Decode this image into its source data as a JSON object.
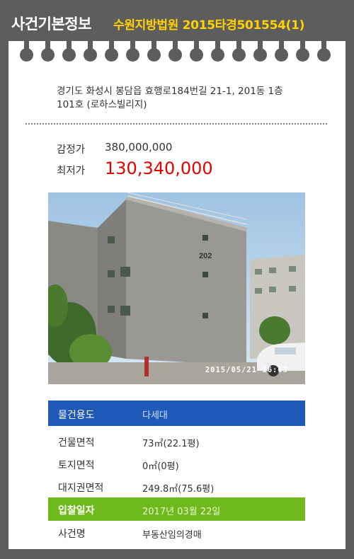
{
  "header": {
    "title": "사건기본정보",
    "case": "수원지방법원 2015타경501554(1)"
  },
  "address": "경기도 화성시 봉담읍 효행로184번길 21-1, 201동 1층101호 (로하스빌리지)",
  "price": {
    "appraisal_label": "감정가",
    "appraisal_value": "380,000,000",
    "lowest_label": "최저가",
    "lowest_value": "130,340,000"
  },
  "photo": {
    "timestamp": "2015/05/21  16:03",
    "building_number": "202"
  },
  "info_rows": [
    {
      "key": "물건용도",
      "value": "다세대"
    },
    {
      "key": "건물면적",
      "value": "73㎡(22.1평)"
    },
    {
      "key": "토지면적",
      "value": "0㎡(0평)"
    },
    {
      "key": "대지권면적",
      "value": "249.8㎡(75.6평)"
    },
    {
      "key": "입찰일자",
      "value": "2017년 03월 22일"
    },
    {
      "key": "사건명",
      "value": "부동산임의경매"
    }
  ],
  "colors": {
    "background": "#5d5d5d",
    "case_accent": "#ffd200",
    "lowest_price": "#e60000",
    "usage_row": "#1f5ab8",
    "bid_date_row": "#6eb91b"
  }
}
